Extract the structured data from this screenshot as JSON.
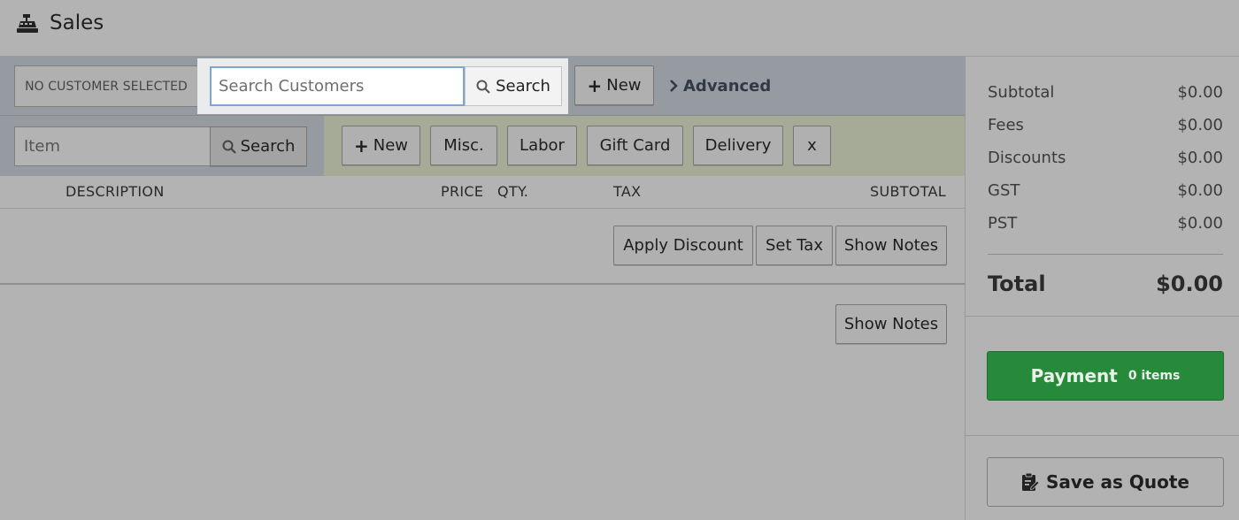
{
  "header": {
    "title": "Sales",
    "icon": "cash-register-icon"
  },
  "customer": {
    "status": "NO CUSTOMER SELECTED",
    "search_placeholder": "Search Customers",
    "search_value": "",
    "search_label": "Search",
    "new_label": "New",
    "advanced_label": "Advanced"
  },
  "items": {
    "input_placeholder": "Item",
    "search_label": "Search",
    "buttons": {
      "new": "New",
      "misc": "Misc.",
      "labor": "Labor",
      "gift_card": "Gift Card",
      "delivery": "Delivery",
      "clear": "x"
    }
  },
  "columns": {
    "description": "DESCRIPTION",
    "price": "PRICE",
    "qty": "QTY.",
    "tax": "TAX",
    "subtotal": "SUBTOTAL"
  },
  "line_actions": {
    "apply_discount": "Apply Discount",
    "set_tax": "Set Tax",
    "show_notes": "Show Notes"
  },
  "notes": {
    "show_notes": "Show Notes"
  },
  "summary": {
    "rows": [
      {
        "label": "Subtotal",
        "value": "$0.00"
      },
      {
        "label": "Fees",
        "value": "$0.00"
      },
      {
        "label": "Discounts",
        "value": "$0.00"
      },
      {
        "label": "GST",
        "value": "$0.00"
      },
      {
        "label": "PST",
        "value": "$0.00"
      }
    ],
    "total_label": "Total",
    "total_value": "$0.00"
  },
  "payment": {
    "label": "Payment",
    "count": "0 items",
    "color": "#268a3a"
  },
  "quote": {
    "label": "Save as Quote"
  }
}
